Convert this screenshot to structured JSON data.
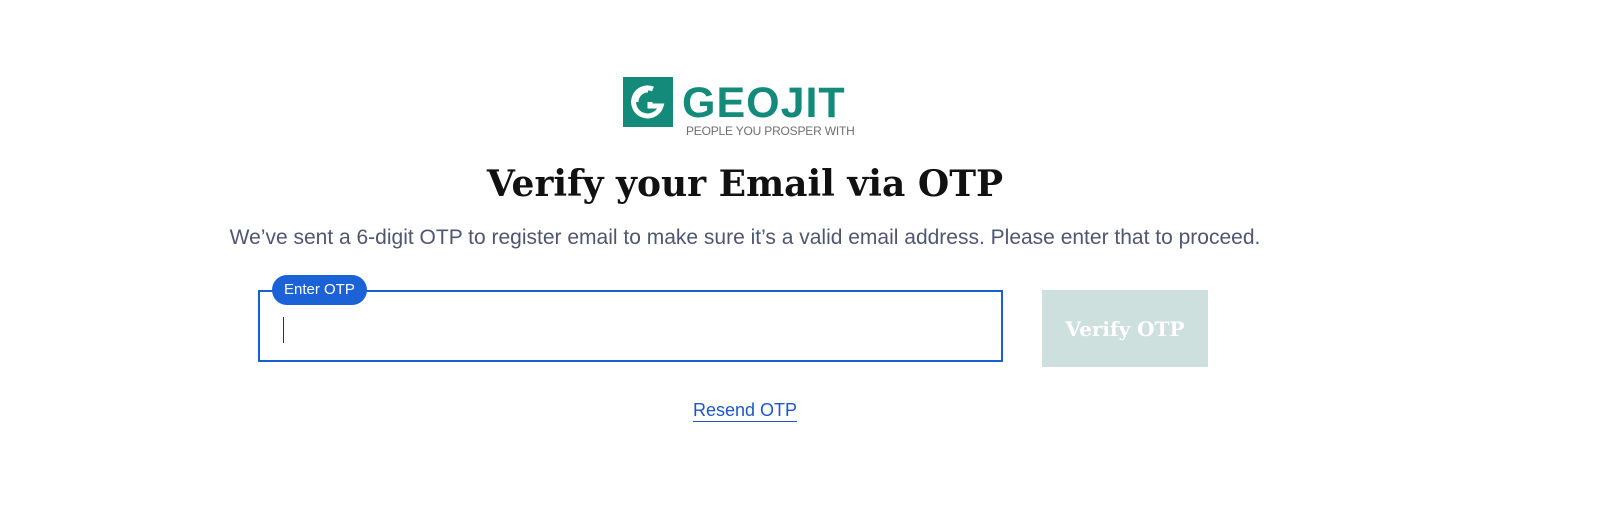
{
  "brand": {
    "name": "GEOJIT",
    "tagline": "PEOPLE YOU PROSPER WITH",
    "mark_icon": "geojit-g-logo-icon",
    "color": "#138a7a"
  },
  "page": {
    "title": "Verify your Email via OTP",
    "subtitle": "We’ve sent a 6-digit OTP to register email to make sure it’s a valid email address. Please enter that to proceed."
  },
  "otp_form": {
    "label": "Enter OTP",
    "value": "",
    "focused": true,
    "accent_color": "#1a62d6",
    "verify_label": "Verify OTP",
    "verify_disabled": true,
    "resend_label": "Resend OTP"
  }
}
